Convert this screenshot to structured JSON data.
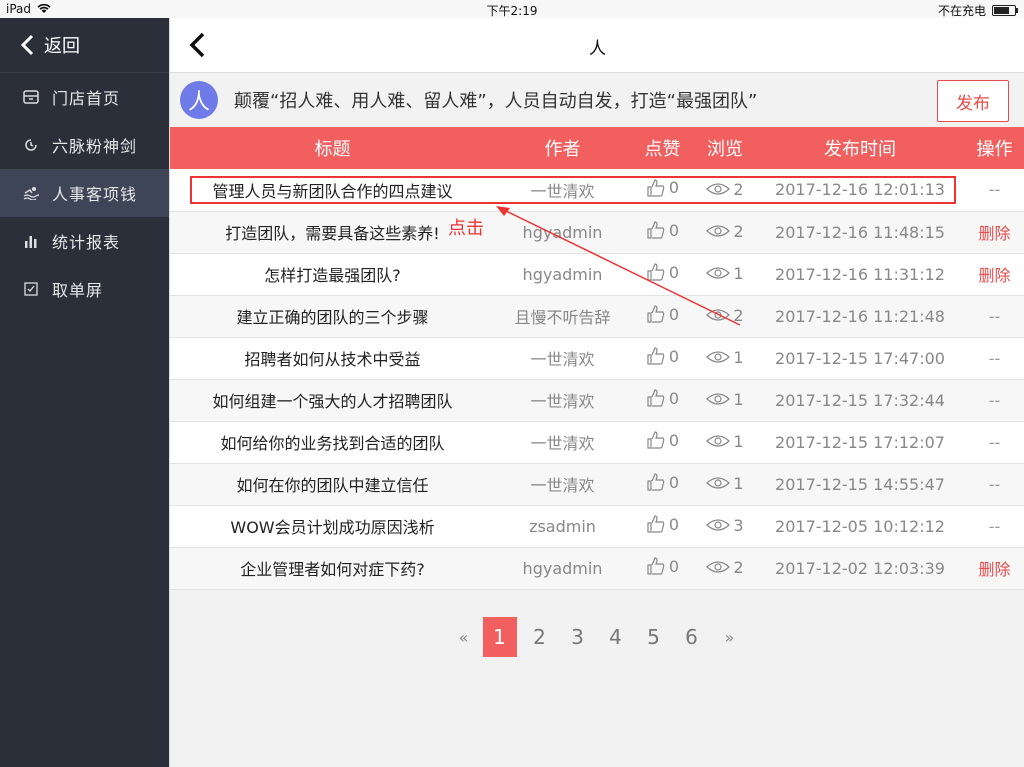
{
  "status": {
    "device": "iPad",
    "time": "下午2:19",
    "charging": "不在充电",
    "battery": 0.85
  },
  "sidebar": {
    "back_label": "返回",
    "items": [
      {
        "label": "门店首页",
        "icon": "store-icon"
      },
      {
        "label": "六脉粉神剑",
        "icon": "refresh-icon"
      },
      {
        "label": "人事客项钱",
        "icon": "swim-icon",
        "active": true
      },
      {
        "label": "统计报表",
        "icon": "bar-chart-icon"
      },
      {
        "label": "取单屏",
        "icon": "checkbox-icon"
      }
    ]
  },
  "header": {
    "title": "人"
  },
  "banner": {
    "avatar_text": "人",
    "text": "颠覆“招人难、用人难、留人难”，人员自动自发，打造“最强团队”",
    "publish_label": "发布"
  },
  "table": {
    "columns": [
      "标题",
      "作者",
      "点赞",
      "浏览",
      "发布时间",
      "操作"
    ],
    "rows": [
      {
        "title": "管理人员与新团队合作的四点建议",
        "author": "一世清欢",
        "likes": "0",
        "views": "2",
        "time": "2017-12-16 12:01:13",
        "op": "--"
      },
      {
        "title": "打造团队，需要具备这些素养!",
        "author": "hgyadmin",
        "likes": "0",
        "views": "2",
        "time": "2017-12-16 11:48:15",
        "op": "删除"
      },
      {
        "title": "怎样打造最强团队?",
        "author": "hgyadmin",
        "likes": "0",
        "views": "1",
        "time": "2017-12-16 11:31:12",
        "op": "删除"
      },
      {
        "title": "建立正确的团队的三个步骤",
        "author": "且慢不听告辞",
        "likes": "0",
        "views": "2",
        "time": "2017-12-16 11:21:48",
        "op": "--"
      },
      {
        "title": "招聘者如何从技术中受益",
        "author": "一世清欢",
        "likes": "0",
        "views": "1",
        "time": "2017-12-15 17:47:00",
        "op": "--"
      },
      {
        "title": "如何组建一个强大的人才招聘团队",
        "author": "一世清欢",
        "likes": "0",
        "views": "1",
        "time": "2017-12-15 17:32:44",
        "op": "--"
      },
      {
        "title": "如何给你的业务找到合适的团队",
        "author": "一世清欢",
        "likes": "0",
        "views": "1",
        "time": "2017-12-15 17:12:07",
        "op": "--"
      },
      {
        "title": "如何在你的团队中建立信任",
        "author": "一世清欢",
        "likes": "0",
        "views": "1",
        "time": "2017-12-15 14:55:47",
        "op": "--"
      },
      {
        "title": "WOW会员计划成功原因浅析",
        "author": "zsadmin",
        "likes": "0",
        "views": "3",
        "time": "2017-12-05 10:12:12",
        "op": "--"
      },
      {
        "title": "企业管理者如何对症下药?",
        "author": "hgyadmin",
        "likes": "0",
        "views": "2",
        "time": "2017-12-02 12:03:39",
        "op": "删除"
      }
    ]
  },
  "annotation": {
    "label": "点击"
  },
  "pager": {
    "prev": "«",
    "pages": [
      "1",
      "2",
      "3",
      "4",
      "5",
      "6"
    ],
    "current": "1",
    "next": "»"
  },
  "colors": {
    "accent": "#f25f5f",
    "sidebar": "#2b2f3a",
    "delete": "#e74c4c"
  }
}
